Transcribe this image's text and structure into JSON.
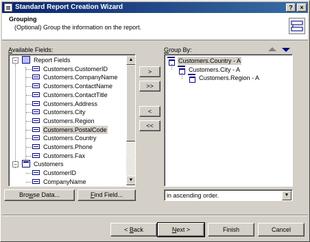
{
  "window": {
    "title": "Standard Report Creation Wizard",
    "help_label": "?",
    "close_label": "×"
  },
  "header": {
    "title": "Grouping",
    "subtitle": "(Optional) Group the information on the report."
  },
  "available": {
    "label_prefix": "",
    "label_hotkey": "A",
    "label_rest": "vailable Fields:",
    "items": [
      {
        "text": "Report Fields",
        "type": "root"
      },
      {
        "text": "Customers.CustomerID",
        "type": "field"
      },
      {
        "text": "Customers.CompanyName",
        "type": "field"
      },
      {
        "text": "Customers.ContactName",
        "type": "field"
      },
      {
        "text": "Customers.ContactTitle",
        "type": "field"
      },
      {
        "text": "Customers.Address",
        "type": "field"
      },
      {
        "text": "Customers.City",
        "type": "field"
      },
      {
        "text": "Customers.Region",
        "type": "field"
      },
      {
        "text": "Customers.PostalCode",
        "type": "field",
        "selected": true
      },
      {
        "text": "Customers.Country",
        "type": "field"
      },
      {
        "text": "Customers.Phone",
        "type": "field"
      },
      {
        "text": "Customers.Fax",
        "type": "field"
      },
      {
        "text": "Customers",
        "type": "table"
      },
      {
        "text": "CustomerID",
        "type": "field"
      },
      {
        "text": "CompanyName",
        "type": "field"
      }
    ],
    "expander_minus": "−"
  },
  "move_buttons": {
    "add": ">",
    "add_all": ">>",
    "remove": "<",
    "remove_all": "<<"
  },
  "group_by": {
    "label_hotkey": "G",
    "label_rest": "roup By:",
    "items": [
      {
        "text": "Customers.Country - A",
        "level": 0,
        "selected": true
      },
      {
        "text": "Customers.City - A",
        "level": 1
      },
      {
        "text": "Customers.Region - A",
        "level": 2
      }
    ]
  },
  "browse_button": {
    "hotkey": "w",
    "before": "Bro",
    "after": "se Data..."
  },
  "find_button": {
    "hotkey": "F",
    "before": "",
    "after": "ind Field..."
  },
  "sort_order": {
    "value": "in ascending order."
  },
  "footer": {
    "back": {
      "before": "< ",
      "hotkey": "B",
      "after": "ack"
    },
    "next": {
      "before": "",
      "hotkey": "N",
      "after": "ext >"
    },
    "finish": "Finish",
    "cancel": "Cancel"
  },
  "colors": {
    "title_start": "#0a246a",
    "title_end": "#3a6ea5",
    "face": "#d4d0c8"
  }
}
